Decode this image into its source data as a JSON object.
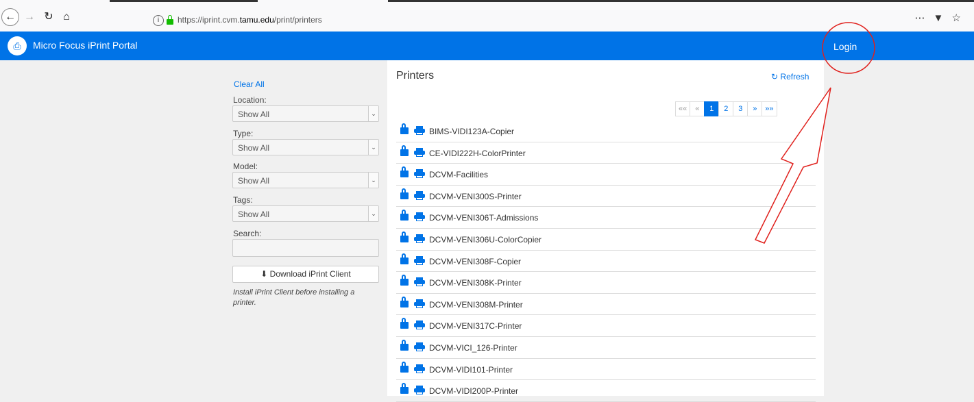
{
  "browser": {
    "url_prefix": "https://iprint.cvm.",
    "url_domain": "tamu.edu",
    "url_path": "/print/printers",
    "menu_glyph": "⋯",
    "pocket_glyph": "▼",
    "star_glyph": "☆"
  },
  "header": {
    "title": "Micro Focus iPrint Portal",
    "login": "Login"
  },
  "sidebar": {
    "clear_all": "Clear All",
    "filters": [
      {
        "label": "Location:",
        "value": "Show All"
      },
      {
        "label": "Type:",
        "value": "Show All"
      },
      {
        "label": "Model:",
        "value": "Show All"
      },
      {
        "label": "Tags:",
        "value": "Show All"
      }
    ],
    "search_label": "Search:",
    "search_value": "",
    "download_label": "Download iPrint Client",
    "install_note": "Install iPrint Client before installing a printer."
  },
  "main": {
    "title": "Printers",
    "refresh": "Refresh",
    "pagination": [
      "««",
      "«",
      "1",
      "2",
      "3",
      "»",
      "»»"
    ],
    "active_page": "1",
    "printers": [
      "BIMS-VIDI123A-Copier",
      "CE-VIDI222H-ColorPrinter",
      "DCVM-Facilities",
      "DCVM-VENI300S-Printer",
      "DCVM-VENI306T-Admissions",
      "DCVM-VENI306U-ColorCopier",
      "DCVM-VENI308F-Copier",
      "DCVM-VENI308K-Printer",
      "DCVM-VENI308M-Printer",
      "DCVM-VENI317C-Printer",
      "DCVM-VICI_126-Printer",
      "DCVM-VIDI101-Printer",
      "DCVM-VIDI200P-Printer"
    ]
  },
  "colors": {
    "accent": "#0073e7",
    "annotation": "#e0201c"
  }
}
